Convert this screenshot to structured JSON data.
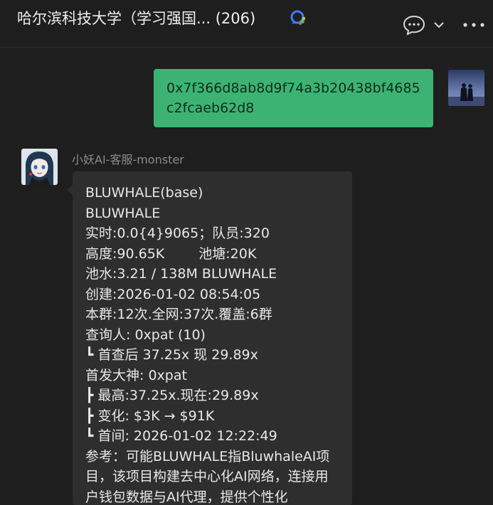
{
  "header": {
    "title": "哈尔滨科技大学（学习强国... (206)"
  },
  "outgoing": {
    "text": "0x7f366d8ab8d9f74a3b20438bf4685c2fcaeb62d8"
  },
  "incoming": {
    "sender": "小妖AI-客服-monster",
    "lines": {
      "l1": "BLUWHALE(base)",
      "l2": "BLUWHALE",
      "l3": "实时:0.0{4}9065；队员:320",
      "l4a": "高度:90.65K",
      "l4b": "池塘:20K",
      "l5": "池水:3.21 / 138M BLUWHALE",
      "l6": "创建:2026-01-02 08:54:05",
      "l7": "本群:12次.全网:37次.覆盖:6群",
      "l8": "查询人: 0xpat (10)",
      "l9": "┗ 首查后 37.25x 现 29.89x",
      "l10": "首发大神: 0xpat",
      "l11": "┣ 最高:37.25x.现在:29.89x",
      "l12": "┣ 变化: $3K → $91K",
      "l13": "┗ 首间: 2026-01-02 12:22:49",
      "l14": "参考：可能BLUWHALE指BluwhaleAI项目，该项目构建去中心化AI网络，连接用户钱包数据与AI代理，提供个性化"
    }
  },
  "icons": {
    "brand": "colorful-chat-brand-icon",
    "chat": "chat-bubble-icon",
    "chevron": "chevron-down-icon",
    "more": "more-dots-icon"
  }
}
